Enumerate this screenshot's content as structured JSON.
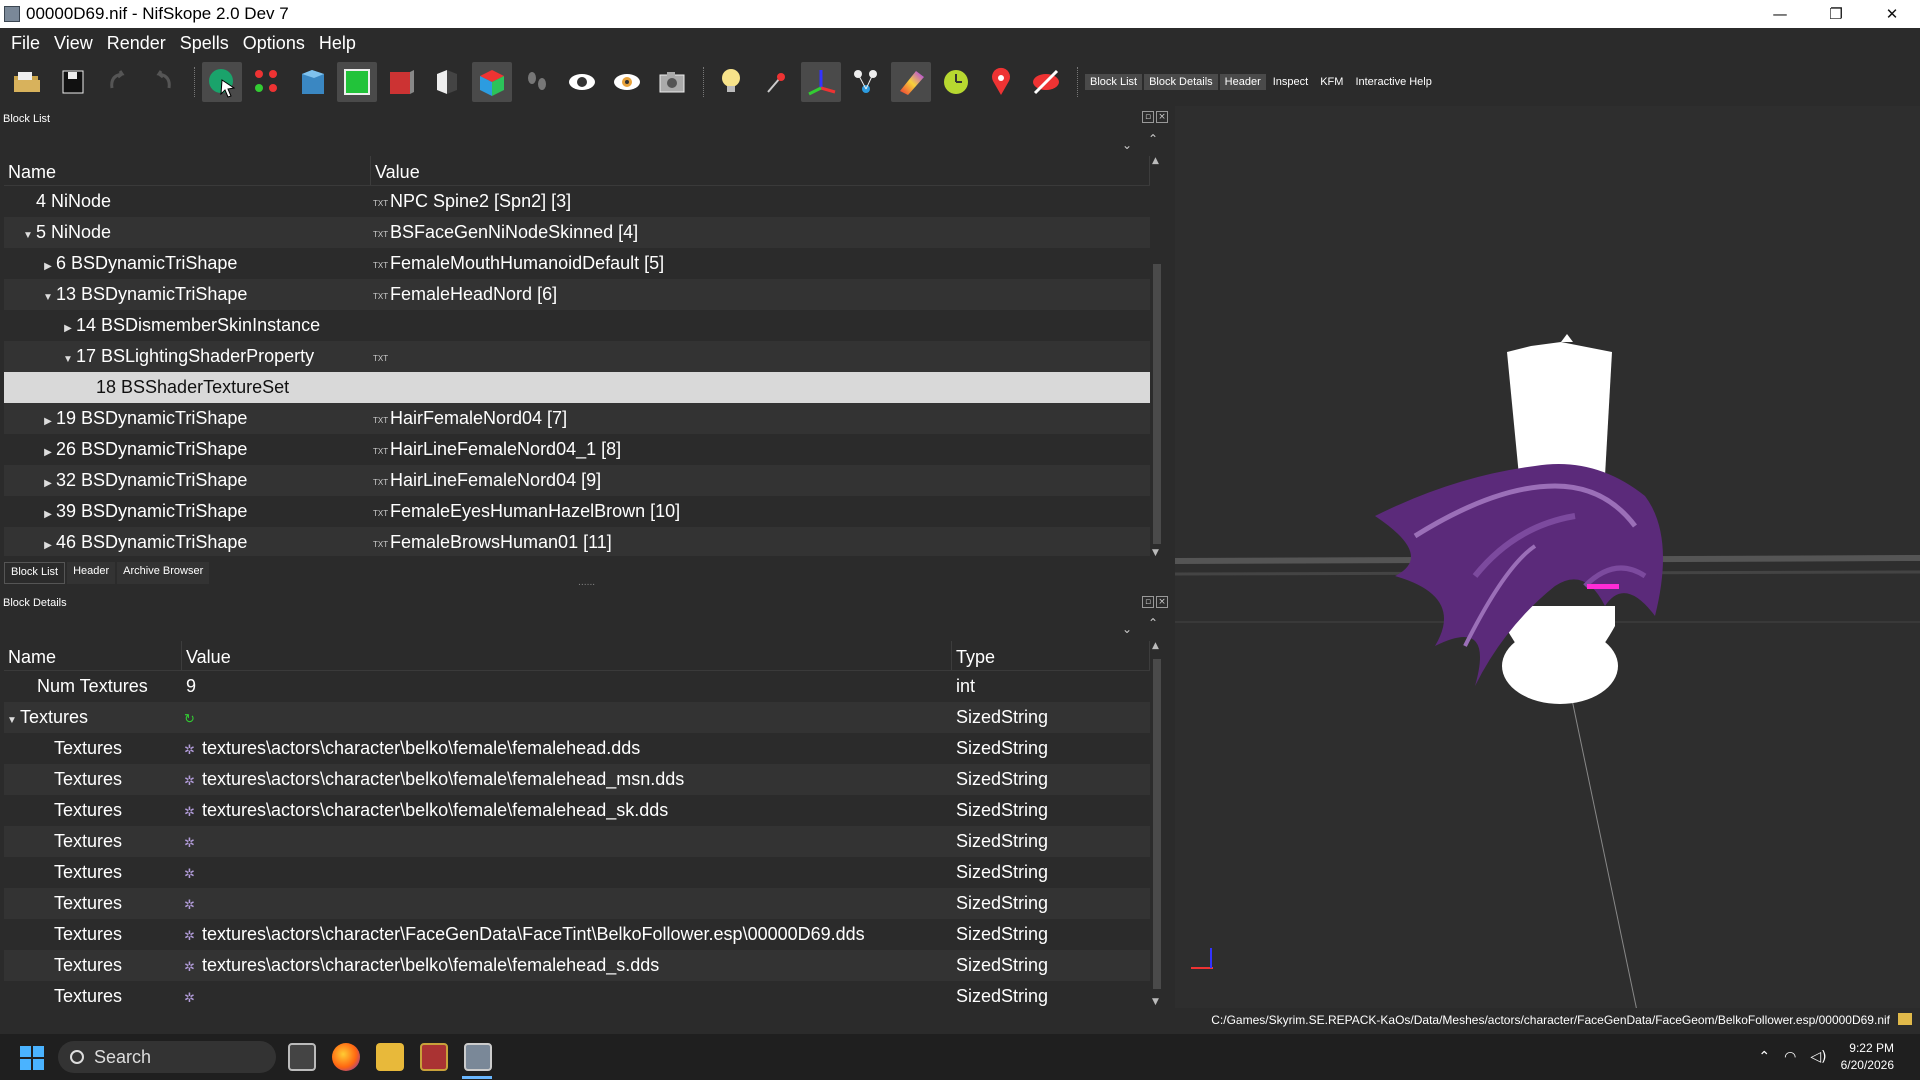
{
  "window": {
    "title": "00000D69.nif - NifSkope 2.0 Dev 7",
    "controls": {
      "minimize": "—",
      "restore": "❐",
      "close": "✕"
    }
  },
  "menu": [
    "File",
    "View",
    "Render",
    "Spells",
    "Options",
    "Help"
  ],
  "toolbar": {
    "icons": [
      "open-icon",
      "save-icon",
      "undo-icon",
      "redo-icon",
      "select-object-icon",
      "select-vertex-icon",
      "view-top-icon",
      "view-front-icon",
      "view-side-icon",
      "view-user-icon",
      "view-perspective-icon",
      "footsteps-icon",
      "eye-icon",
      "eye-alt-icon",
      "screenshot-icon",
      "light-bulb-icon",
      "pin-icon",
      "axes-icon",
      "nodes-icon",
      "gradient-icon",
      "clock-icon",
      "marker-icon",
      "no-visibility-icon"
    ],
    "text_buttons": [
      "Block List",
      "Block Details",
      "Header",
      "Inspect",
      "KFM",
      "Interactive Help"
    ]
  },
  "block_list": {
    "title": "Block List",
    "columns": [
      "Name",
      "Value"
    ],
    "rows": [
      {
        "name": "4 NiNode",
        "value": "NPC Spine2 [Spn2] [3]",
        "indent": 1,
        "arrow": "",
        "txt": true
      },
      {
        "name": "5 NiNode",
        "value": "BSFaceGenNiNodeSkinned [4]",
        "indent": 1,
        "arrow": "▼",
        "txt": true
      },
      {
        "name": "6 BSDynamicTriShape",
        "value": "FemaleMouthHumanoidDefault [5]",
        "indent": 2,
        "arrow": "▶",
        "txt": true
      },
      {
        "name": "13 BSDynamicTriShape",
        "value": "FemaleHeadNord [6]",
        "indent": 2,
        "arrow": "▼",
        "txt": true
      },
      {
        "name": "14 BSDismemberSkinInstance",
        "value": "",
        "indent": 3,
        "arrow": "▶",
        "txt": false
      },
      {
        "name": "17 BSLightingShaderProperty",
        "value": "",
        "indent": 3,
        "arrow": "▼",
        "txt": true
      },
      {
        "name": "18 BSShaderTextureSet",
        "value": "",
        "indent": 4,
        "arrow": "",
        "txt": false,
        "selected": true
      },
      {
        "name": "19 BSDynamicTriShape",
        "value": "HairFemaleNord04 [7]",
        "indent": 2,
        "arrow": "▶",
        "txt": true
      },
      {
        "name": "26 BSDynamicTriShape",
        "value": "HairLineFemaleNord04_1 [8]",
        "indent": 2,
        "arrow": "▶",
        "txt": true
      },
      {
        "name": "32 BSDynamicTriShape",
        "value": "HairLineFemaleNord04 [9]",
        "indent": 2,
        "arrow": "▶",
        "txt": true
      },
      {
        "name": "39 BSDynamicTriShape",
        "value": "FemaleEyesHumanHazelBrown [10]",
        "indent": 2,
        "arrow": "▶",
        "txt": true
      },
      {
        "name": "46 BSDynamicTriShape",
        "value": "FemaleBrowsHuman01 [11]",
        "indent": 2,
        "arrow": "▶",
        "txt": true
      }
    ],
    "txt_badge": "TXT"
  },
  "tabs": [
    "Block List",
    "Header",
    "Archive Browser"
  ],
  "splitter": "......",
  "block_details": {
    "title": "Block Details",
    "columns": [
      "Name",
      "Value",
      "Type"
    ],
    "rows": [
      {
        "name": "Num Textures",
        "value": "9",
        "type": "int",
        "indent": 1,
        "arrow": "",
        "icon": ""
      },
      {
        "name": "Textures",
        "value": "",
        "type": "SizedString",
        "indent": 0,
        "arrow": "▼",
        "icon": "refresh"
      },
      {
        "name": "Textures",
        "value": "textures\\actors\\character\\belko\\female\\femalehead.dds",
        "type": "SizedString",
        "indent": 2,
        "arrow": "",
        "icon": "gear"
      },
      {
        "name": "Textures",
        "value": "textures\\actors\\character\\belko\\female\\femalehead_msn.dds",
        "type": "SizedString",
        "indent": 2,
        "arrow": "",
        "icon": "gear"
      },
      {
        "name": "Textures",
        "value": "textures\\actors\\character\\belko\\female\\femalehead_sk.dds",
        "type": "SizedString",
        "indent": 2,
        "arrow": "",
        "icon": "gear"
      },
      {
        "name": "Textures",
        "value": "",
        "type": "SizedString",
        "indent": 2,
        "arrow": "",
        "icon": "gear"
      },
      {
        "name": "Textures",
        "value": "",
        "type": "SizedString",
        "indent": 2,
        "arrow": "",
        "icon": "gear"
      },
      {
        "name": "Textures",
        "value": "",
        "type": "SizedString",
        "indent": 2,
        "arrow": "",
        "icon": "gear"
      },
      {
        "name": "Textures",
        "value": "textures\\actors\\character\\FaceGenData\\FaceTint\\BelkoFollower.esp\\00000D69.dds",
        "type": "SizedString",
        "indent": 2,
        "arrow": "",
        "icon": "gear"
      },
      {
        "name": "Textures",
        "value": "textures\\actors\\character\\belko\\female\\femalehead_s.dds",
        "type": "SizedString",
        "indent": 2,
        "arrow": "",
        "icon": "gear"
      },
      {
        "name": "Textures",
        "value": "",
        "type": "SizedString",
        "indent": 2,
        "arrow": "",
        "icon": "gear"
      }
    ]
  },
  "status": {
    "path": "C:/Games/Skyrim.SE.REPACK-KaOs/Data/Meshes/actors/character/FaceGenData/FaceGeom/BelkoFollower.esp/00000D69.nif"
  },
  "taskbar": {
    "search_label": "Search",
    "time": "9:22 PM",
    "date": "6/20/2026",
    "apps": [
      "task-view-icon",
      "firefox-icon",
      "file-explorer-icon",
      "winrar-icon",
      "nifskope-icon"
    ]
  },
  "colors": {
    "background": "#2b2b2b",
    "selected_row": "#d9d9d9",
    "hair": "#5b2a7a",
    "accent": "#4ab3ff"
  }
}
